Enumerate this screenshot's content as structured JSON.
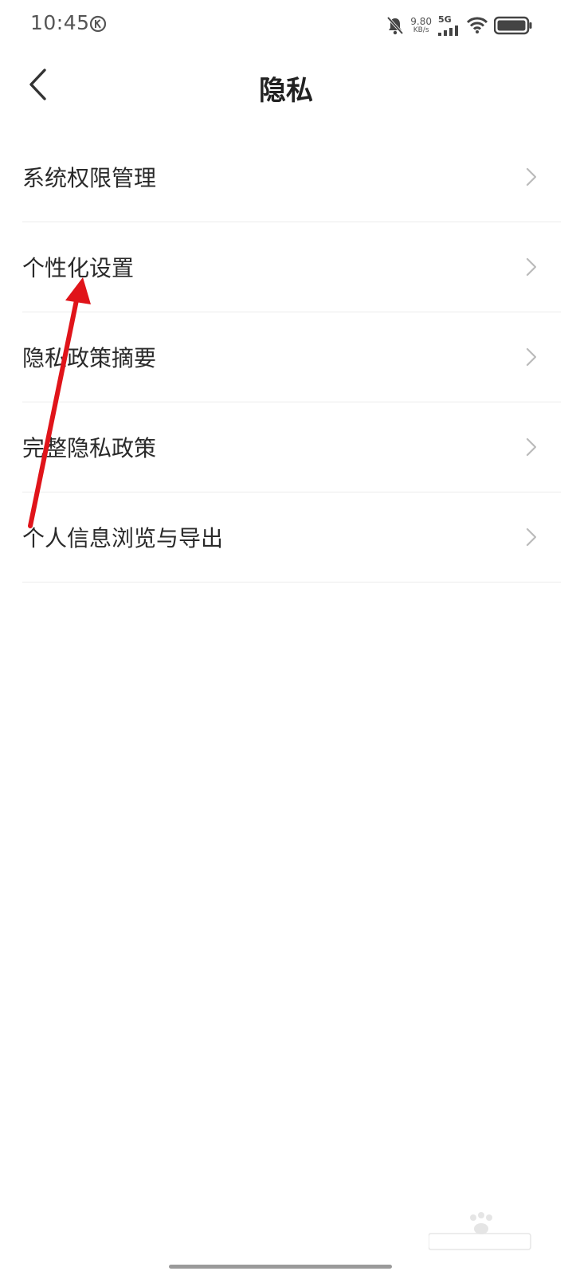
{
  "status_bar": {
    "time": "10:45",
    "net_speed_value": "9.80",
    "net_speed_unit": "KB/s",
    "network_type": "5G",
    "icons": [
      "k-icon",
      "bell-muted-icon",
      "signal-icon",
      "wifi-icon",
      "battery-icon"
    ]
  },
  "header": {
    "title": "隐私",
    "back_icon": "back-arrow-icon"
  },
  "menu": {
    "items": [
      {
        "label": "系统权限管理"
      },
      {
        "label": "个性化设置"
      },
      {
        "label": "隐私政策摘要"
      },
      {
        "label": "完整隐私政策"
      },
      {
        "label": "个人信息浏览与导出"
      }
    ],
    "chevron_icon": "chevron-right-icon"
  },
  "annotation": {
    "arrow_color": "#e0141a"
  },
  "colors": {
    "background": "#ffffff",
    "text_primary": "#2a2a2a",
    "divider": "#ececec",
    "chevron": "#bbbbbb"
  }
}
